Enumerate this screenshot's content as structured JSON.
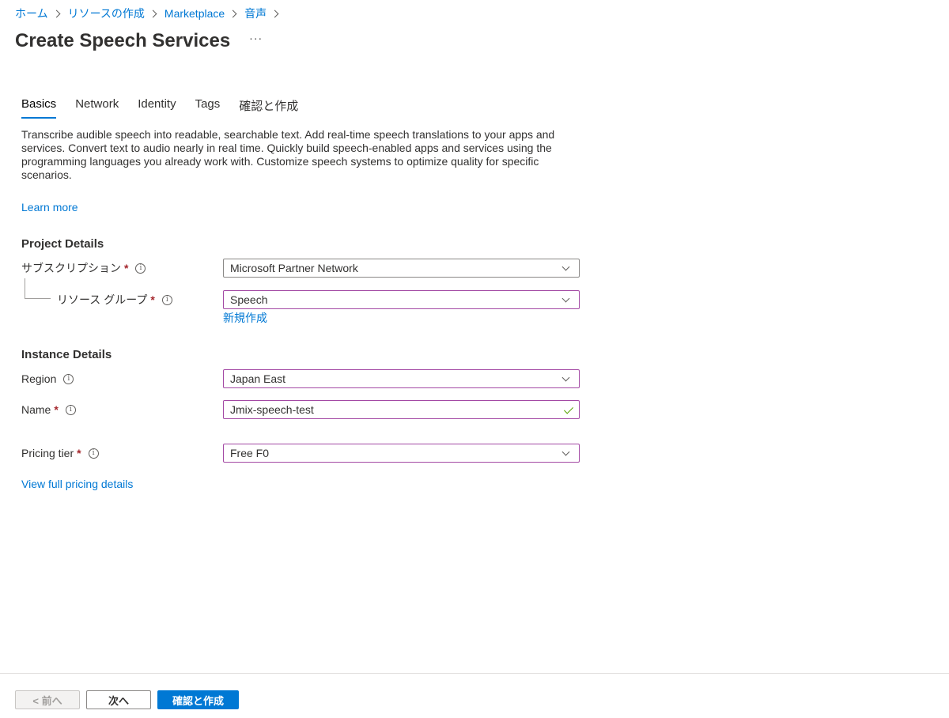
{
  "breadcrumb": [
    "ホーム",
    "リソースの作成",
    "Marketplace",
    "音声"
  ],
  "page": {
    "title": "Create Speech Services",
    "more": "···"
  },
  "tabs": [
    "Basics",
    "Network",
    "Identity",
    "Tags",
    "確認と作成"
  ],
  "description": "Transcribe audible speech into readable, searchable text. Add real-time speech translations to your apps and services. Convert text to audio nearly in real time. Quickly build speech-enabled apps and services using the programming languages you already work with. Customize speech systems to optimize quality for specific scenarios.",
  "learn_more": "Learn more",
  "project": {
    "title": "Project Details",
    "subscription_label": "サブスクリプション",
    "subscription_value": "Microsoft Partner Network",
    "resource_group_label": "リソース グループ",
    "resource_group_value": "Speech",
    "create_new": "新規作成"
  },
  "instance": {
    "title": "Instance Details",
    "region_label": "Region",
    "region_value": "Japan East",
    "name_label": "Name",
    "name_value": "Jmix-speech-test",
    "pricing_label": "Pricing tier",
    "pricing_value": "Free F0",
    "pricing_link": "View full pricing details"
  },
  "required_marker": "*",
  "info_glyph": "i",
  "footer": {
    "prev": "< 前へ",
    "next": "次へ",
    "create": "確認と作成"
  },
  "colors": {
    "accent": "#0078d4",
    "focus_border": "#a349a4",
    "required": "#a4262c",
    "valid": "#57a300"
  }
}
